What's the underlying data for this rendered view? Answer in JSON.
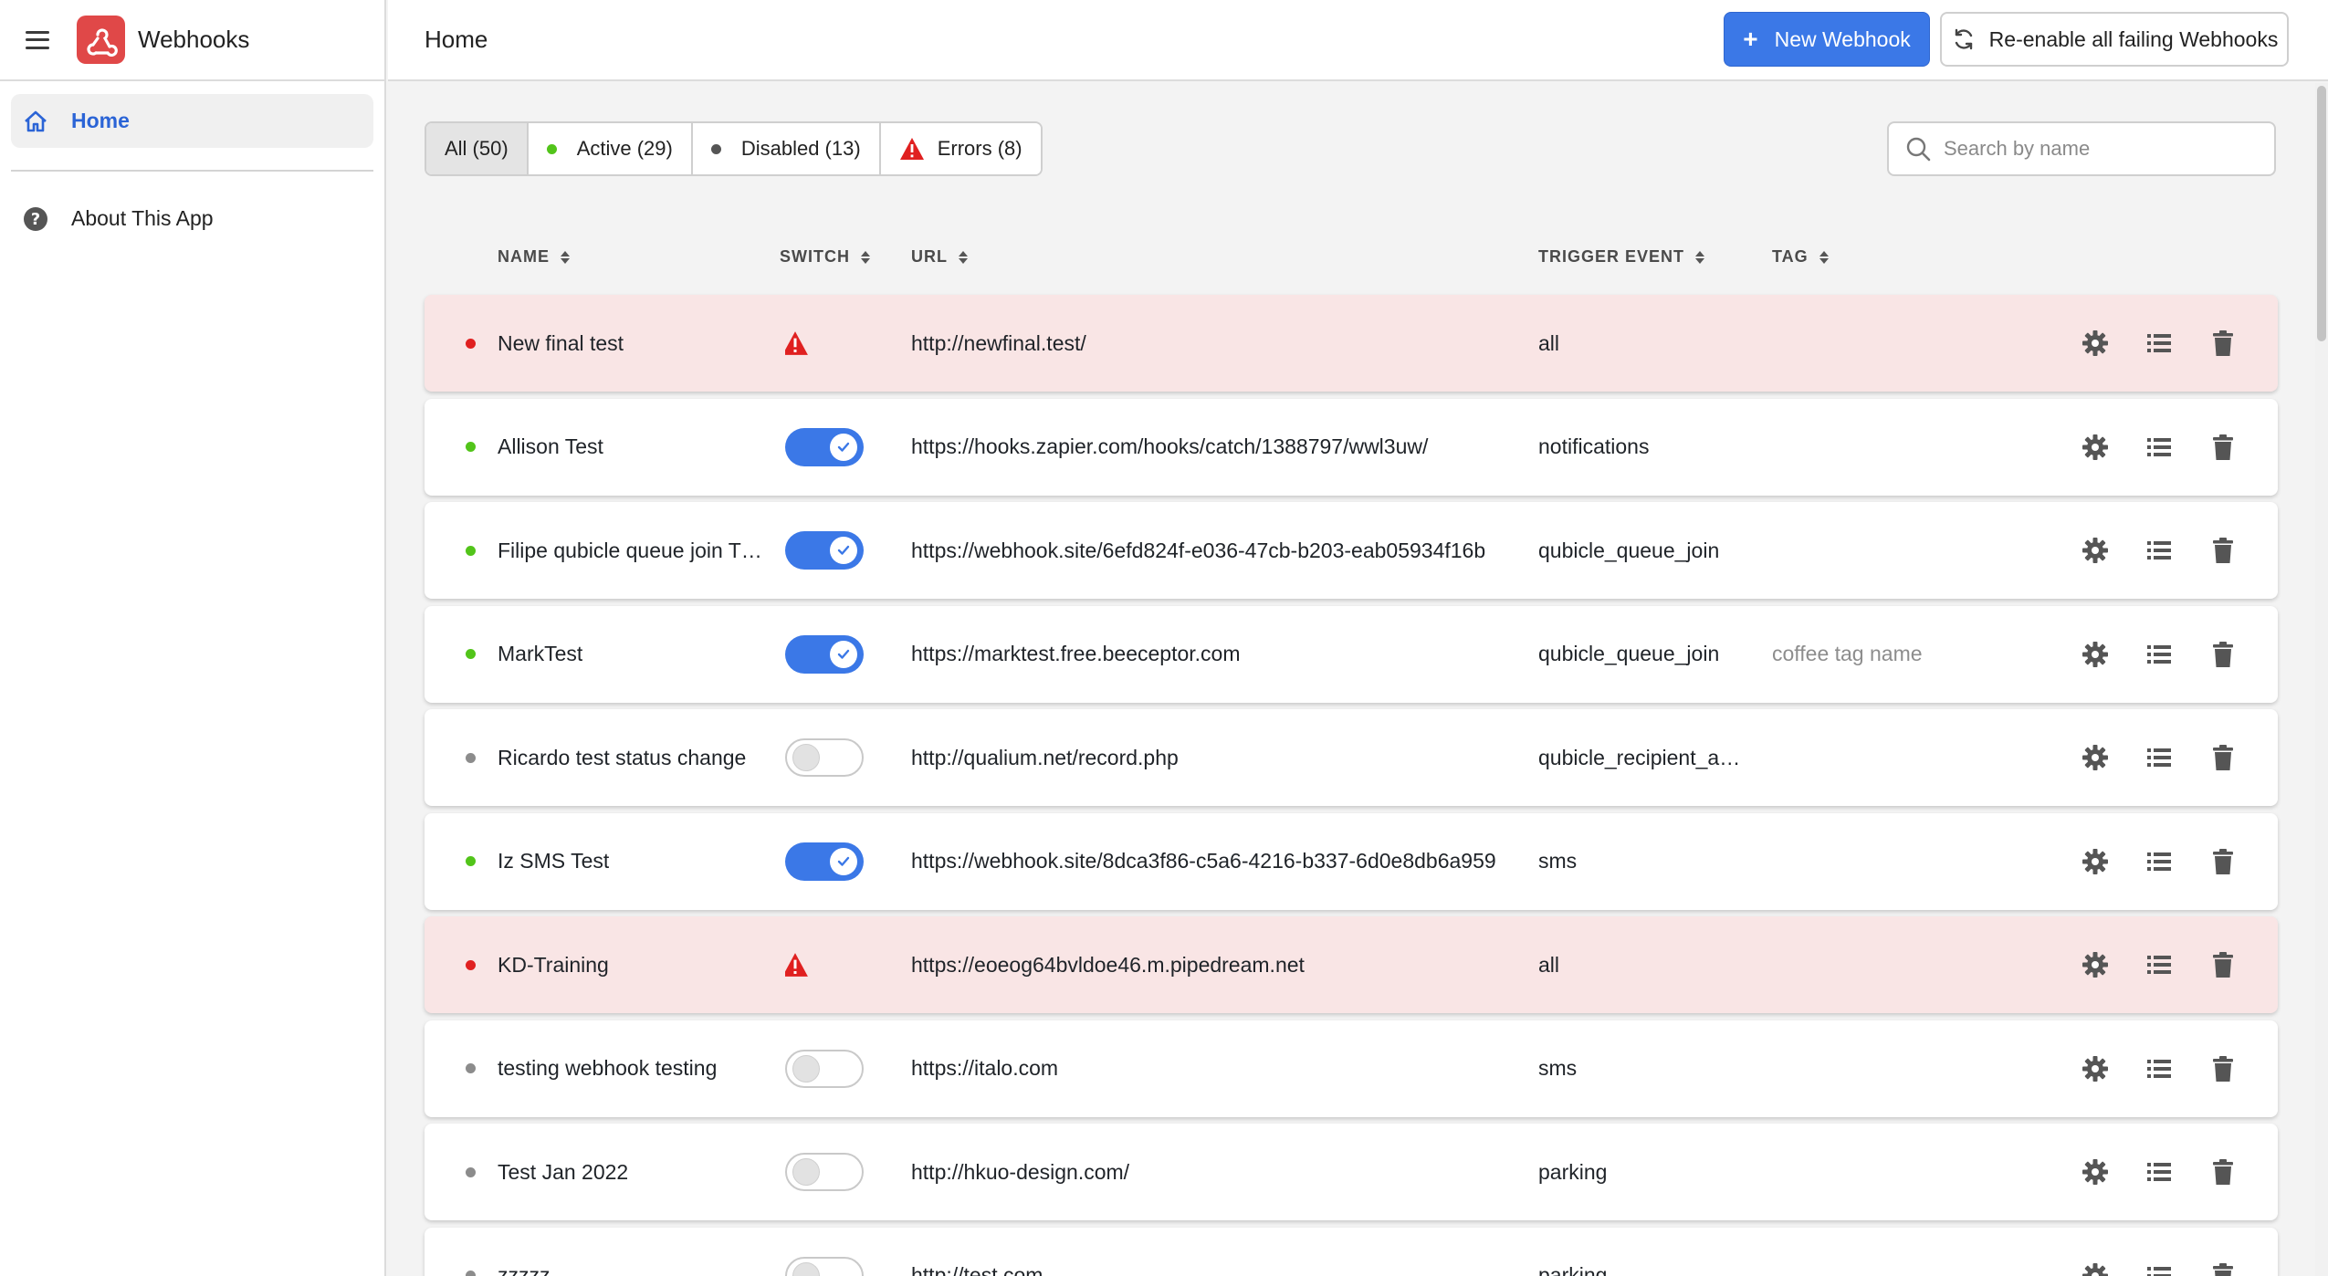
{
  "app": {
    "title": "Webhooks"
  },
  "sidebar": {
    "items": [
      {
        "label": "Home",
        "icon": "home-icon",
        "active": true
      },
      {
        "label": "About This App",
        "icon": "help-circle-icon",
        "active": false
      }
    ]
  },
  "header": {
    "page_title": "Home",
    "new_button": "New Webhook",
    "reenable_button": "Re-enable all failing Webhooks"
  },
  "filters": [
    {
      "label": "All (50)",
      "selected": true
    },
    {
      "label": "Active (29)",
      "selected": false,
      "dot_color": "#52c41a"
    },
    {
      "label": "Disabled (13)",
      "selected": false,
      "dot_color": "#555555"
    },
    {
      "label": "Errors (8)",
      "selected": false,
      "icon": "warning-icon"
    }
  ],
  "search": {
    "placeholder": "Search by name"
  },
  "columns": {
    "name": "NAME",
    "switch": "SWITCH",
    "url": "URL",
    "trigger": "TRIGGER EVENT",
    "tag": "TAG"
  },
  "colors": {
    "accent": "#3b78e7",
    "error_row": "#f9e5e5",
    "status_active": "#52c41a",
    "status_error": "#e02020",
    "status_disabled": "#8c8c8c"
  },
  "rows": [
    {
      "status": "error",
      "name": "New final test",
      "switch": "error",
      "url": "http://newfinal.test/",
      "trigger": "all",
      "tag": ""
    },
    {
      "status": "active",
      "name": "Allison Test",
      "switch": "on",
      "url": "https://hooks.zapier.com/hooks/catch/1388797/wwl3uw/",
      "trigger": "notifications",
      "tag": ""
    },
    {
      "status": "active",
      "name": "Filipe qubicle queue join T…",
      "switch": "on",
      "url": "https://webhook.site/6efd824f-e036-47cb-b203-eab05934f16b",
      "trigger": "qubicle_queue_join",
      "tag": ""
    },
    {
      "status": "active",
      "name": "MarkTest",
      "switch": "on",
      "url": "https://marktest.free.beeceptor.com",
      "trigger": "qubicle_queue_join",
      "tag": "coffee tag name"
    },
    {
      "status": "disabled",
      "name": "Ricardo test status change",
      "switch": "off",
      "url": "http://qualium.net/record.php",
      "trigger": "qubicle_recipient_a…",
      "tag": ""
    },
    {
      "status": "active",
      "name": "Iz SMS Test",
      "switch": "on",
      "url": "https://webhook.site/8dca3f86-c5a6-4216-b337-6d0e8db6a959",
      "trigger": "sms",
      "tag": ""
    },
    {
      "status": "error",
      "name": "KD-Training",
      "switch": "error",
      "url": "https://eoeog64bvldoe46.m.pipedream.net",
      "trigger": "all",
      "tag": ""
    },
    {
      "status": "disabled",
      "name": "testing webhook testing",
      "switch": "off",
      "url": "https://italo.com",
      "trigger": "sms",
      "tag": ""
    },
    {
      "status": "disabled",
      "name": "Test Jan 2022",
      "switch": "off",
      "url": "http://hkuo-design.com/",
      "trigger": "parking",
      "tag": ""
    },
    {
      "status": "disabled",
      "name": "zzzzz",
      "switch": "off",
      "url": "http://test.com",
      "trigger": "parking",
      "tag": ""
    }
  ]
}
